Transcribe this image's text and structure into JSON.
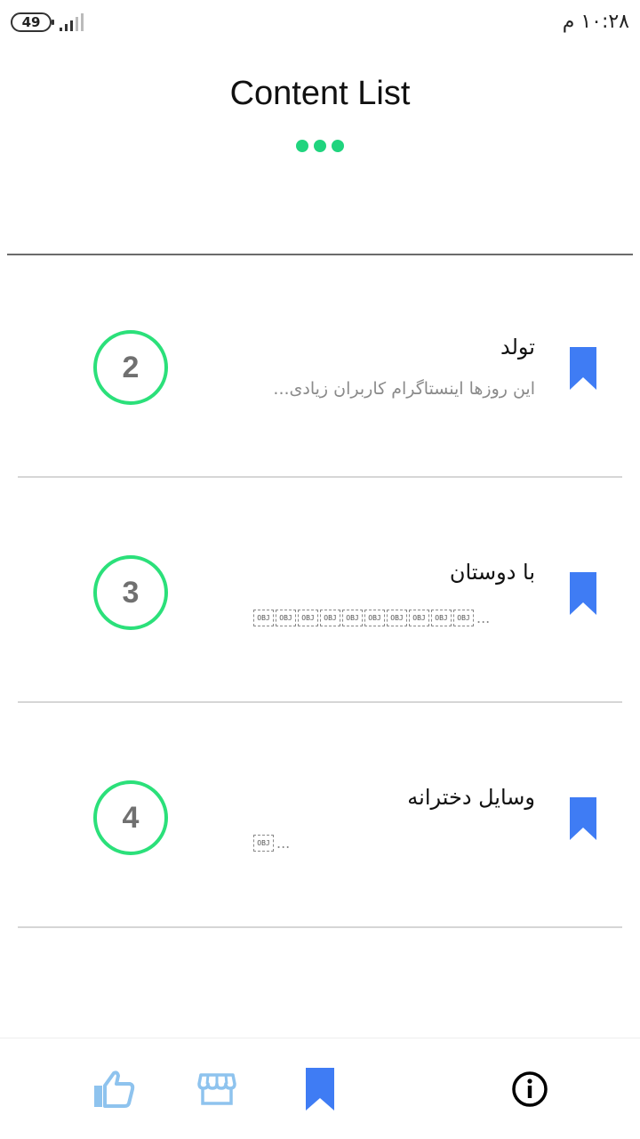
{
  "status_bar": {
    "battery": "49",
    "time": "۱۰:۲۸ م"
  },
  "header": {
    "title": "Content List"
  },
  "items": [
    {
      "number": "2",
      "title": "تولد",
      "subtitle": "این روزها اینستاگرام کاربران زیادی..."
    },
    {
      "number": "3",
      "title": "با دوستان",
      "obj_glyph": "OBJ",
      "obj_ellipsis": "..."
    },
    {
      "number": "4",
      "title": "وسایل دخترانه",
      "obj_glyph": "OBJ",
      "obj_ellipsis": "..."
    }
  ],
  "bottom_nav": {
    "items": [
      {
        "icon": "thumbs-up-icon"
      },
      {
        "icon": "store-icon"
      },
      {
        "icon": "bookmark-icon"
      },
      {
        "icon": "info-icon"
      }
    ]
  },
  "colors": {
    "accent_green": "#20d47e",
    "badge_ring": "#2be07a",
    "bookmark_blue": "#3f7cf4",
    "nav_inactive": "#8ec3ee"
  }
}
